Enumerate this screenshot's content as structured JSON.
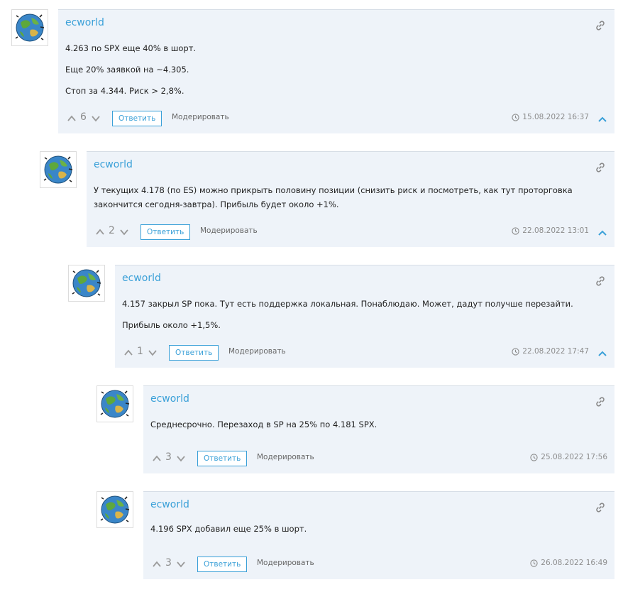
{
  "colors": {
    "accent": "#3aa0d8",
    "card_bg": "#eef3f9",
    "muted": "#8c8c8c"
  },
  "comments": [
    {
      "author": "ecworld",
      "paragraphs": [
        "4.263 по SPX еще 40% в шорт.",
        "Еще 20% заявкой на ~4.305.",
        "Стоп за 4.344. Риск > 2,8%."
      ],
      "votes": "6",
      "reply_label": "Ответить",
      "moderate_label": "Модерировать",
      "date": "15.08.2022 16:37",
      "collapsible": true
    },
    {
      "author": "ecworld",
      "paragraphs": [
        "У текущих 4.178 (по ES) можно прикрыть половину позиции (снизить риск и посмотреть, как тут проторговка закончится сегодня-завтра). Прибыль будет около +1%."
      ],
      "votes": "2",
      "reply_label": "Ответить",
      "moderate_label": "Модерировать",
      "date": "22.08.2022 13:01",
      "collapsible": true
    },
    {
      "author": "ecworld",
      "paragraphs": [
        "4.157 закрыл SP пока. Тут есть поддержка локальная. Понаблюдаю. Может, дадут получше перезайти.",
        "Прибыль около +1,5%."
      ],
      "votes": "1",
      "reply_label": "Ответить",
      "moderate_label": "Модерировать",
      "date": "22.08.2022 17:47",
      "collapsible": true
    },
    {
      "author": "ecworld",
      "paragraphs": [
        "Среднесрочно. Перезаход в SP на 25% по 4.181 SPX."
      ],
      "votes": "3",
      "reply_label": "Ответить",
      "moderate_label": "Модерировать",
      "date": "25.08.2022 17:56",
      "collapsible": false
    },
    {
      "author": "ecworld",
      "paragraphs": [
        "4.196 SPX добавил еще 25% в шорт."
      ],
      "votes": "3",
      "reply_label": "Ответить",
      "moderate_label": "Модерировать",
      "date": "26.08.2022 16:49",
      "collapsible": false
    }
  ]
}
